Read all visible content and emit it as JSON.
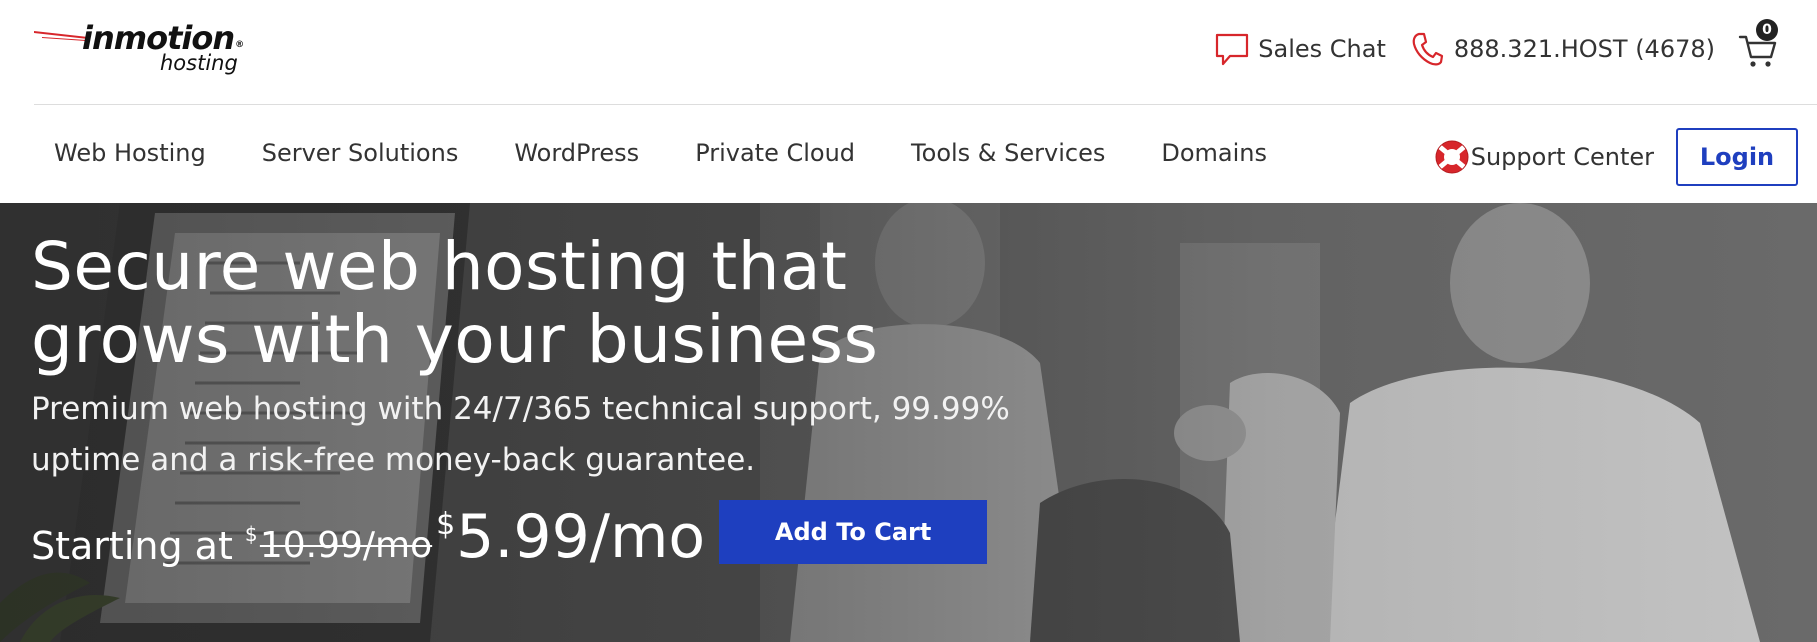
{
  "brand": {
    "name": "inmotion",
    "registered": "®",
    "sub": "hosting"
  },
  "contact": {
    "sales_chat": "Sales Chat",
    "phone": "888.321.HOST (4678)"
  },
  "cart": {
    "count": "0"
  },
  "nav": {
    "items": [
      {
        "label": "Web Hosting"
      },
      {
        "label": "Server Solutions"
      },
      {
        "label": "WordPress"
      },
      {
        "label": "Private Cloud"
      },
      {
        "label": "Tools & Services"
      },
      {
        "label": "Domains"
      }
    ],
    "support": "Support Center",
    "login": "Login"
  },
  "hero": {
    "title_line1": "Secure web hosting that",
    "title_line2": "grows with your business",
    "subtitle": "Premium web hosting with 24/7/365 technical support, 99.99% uptime and a risk-free money-back guarantee.",
    "starting_label": "Starting at",
    "currency": "$",
    "old_price": "10.99/mo",
    "new_price": "5.99/mo",
    "cta": "Add To Cart"
  },
  "colors": {
    "accent_red": "#d7262b",
    "primary_blue": "#1e3fbf",
    "text_dark": "#333333"
  },
  "icons": {
    "chat": "chat-bubble-icon",
    "phone": "phone-icon",
    "cart": "shopping-cart-icon",
    "support": "lifebuoy-icon"
  }
}
